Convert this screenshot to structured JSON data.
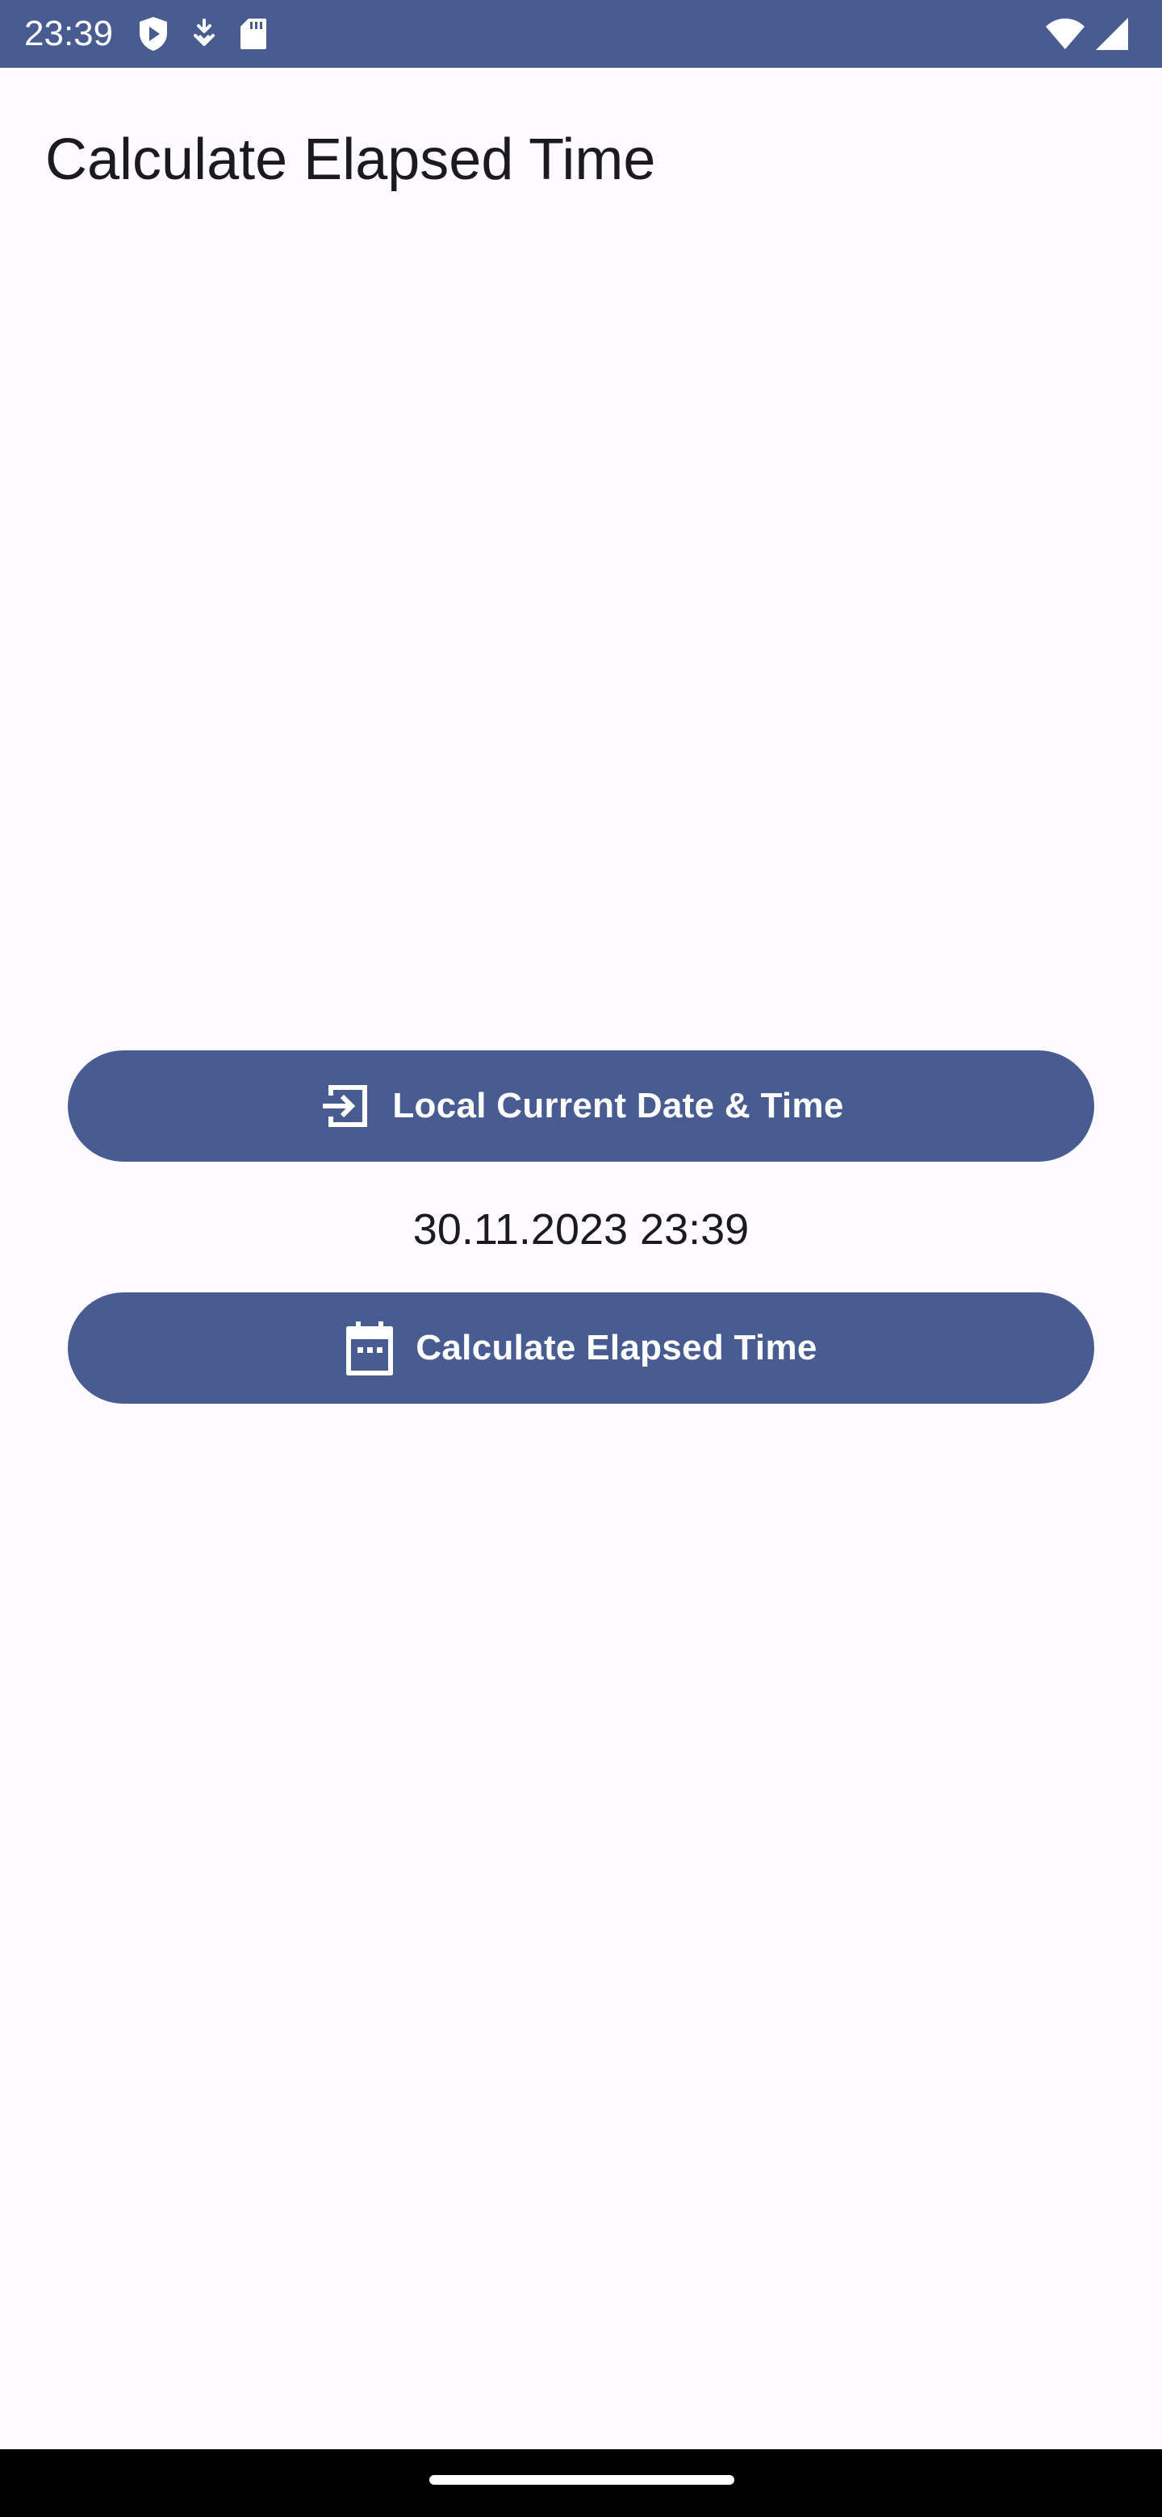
{
  "status_bar": {
    "time": "23:39",
    "left_icons": [
      "shield-play-icon",
      "download-arrows-icon",
      "sd-card-icon"
    ],
    "right_icons": [
      "wifi-icon",
      "signal-icon"
    ],
    "background_color": "#495c92"
  },
  "header": {
    "title": "Calculate Elapsed Time"
  },
  "main": {
    "local_button": {
      "label": "Local Current Date & Time",
      "icon": "login-arrow-icon"
    },
    "current_datetime": "30.11.2023 23:39",
    "calculate_button": {
      "label": "Calculate Elapsed Time",
      "icon": "calendar-icon"
    },
    "accent_color": "#495c92"
  },
  "nav_bar": {
    "handle": "home-gesture-handle"
  }
}
